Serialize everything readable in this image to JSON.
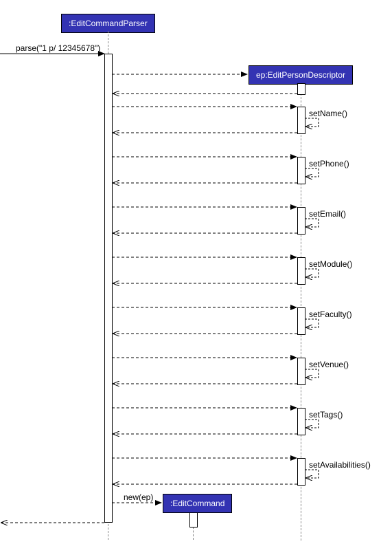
{
  "participants": {
    "parser": ":EditCommandParser",
    "descriptor": "ep:EditPersonDescriptor",
    "command": ":EditCommand"
  },
  "messages": {
    "parse": "parse(\"1 p/ 12345678\")",
    "setName": "setName()",
    "setPhone": "setPhone()",
    "setEmail": "setEmail()",
    "setModule": "setModule()",
    "setFaculty": "setFaculty()",
    "setVenue": "setVenue()",
    "setTags": "setTags()",
    "setAvailabilities": "setAvailabilities()",
    "newEp": "new(ep)"
  }
}
